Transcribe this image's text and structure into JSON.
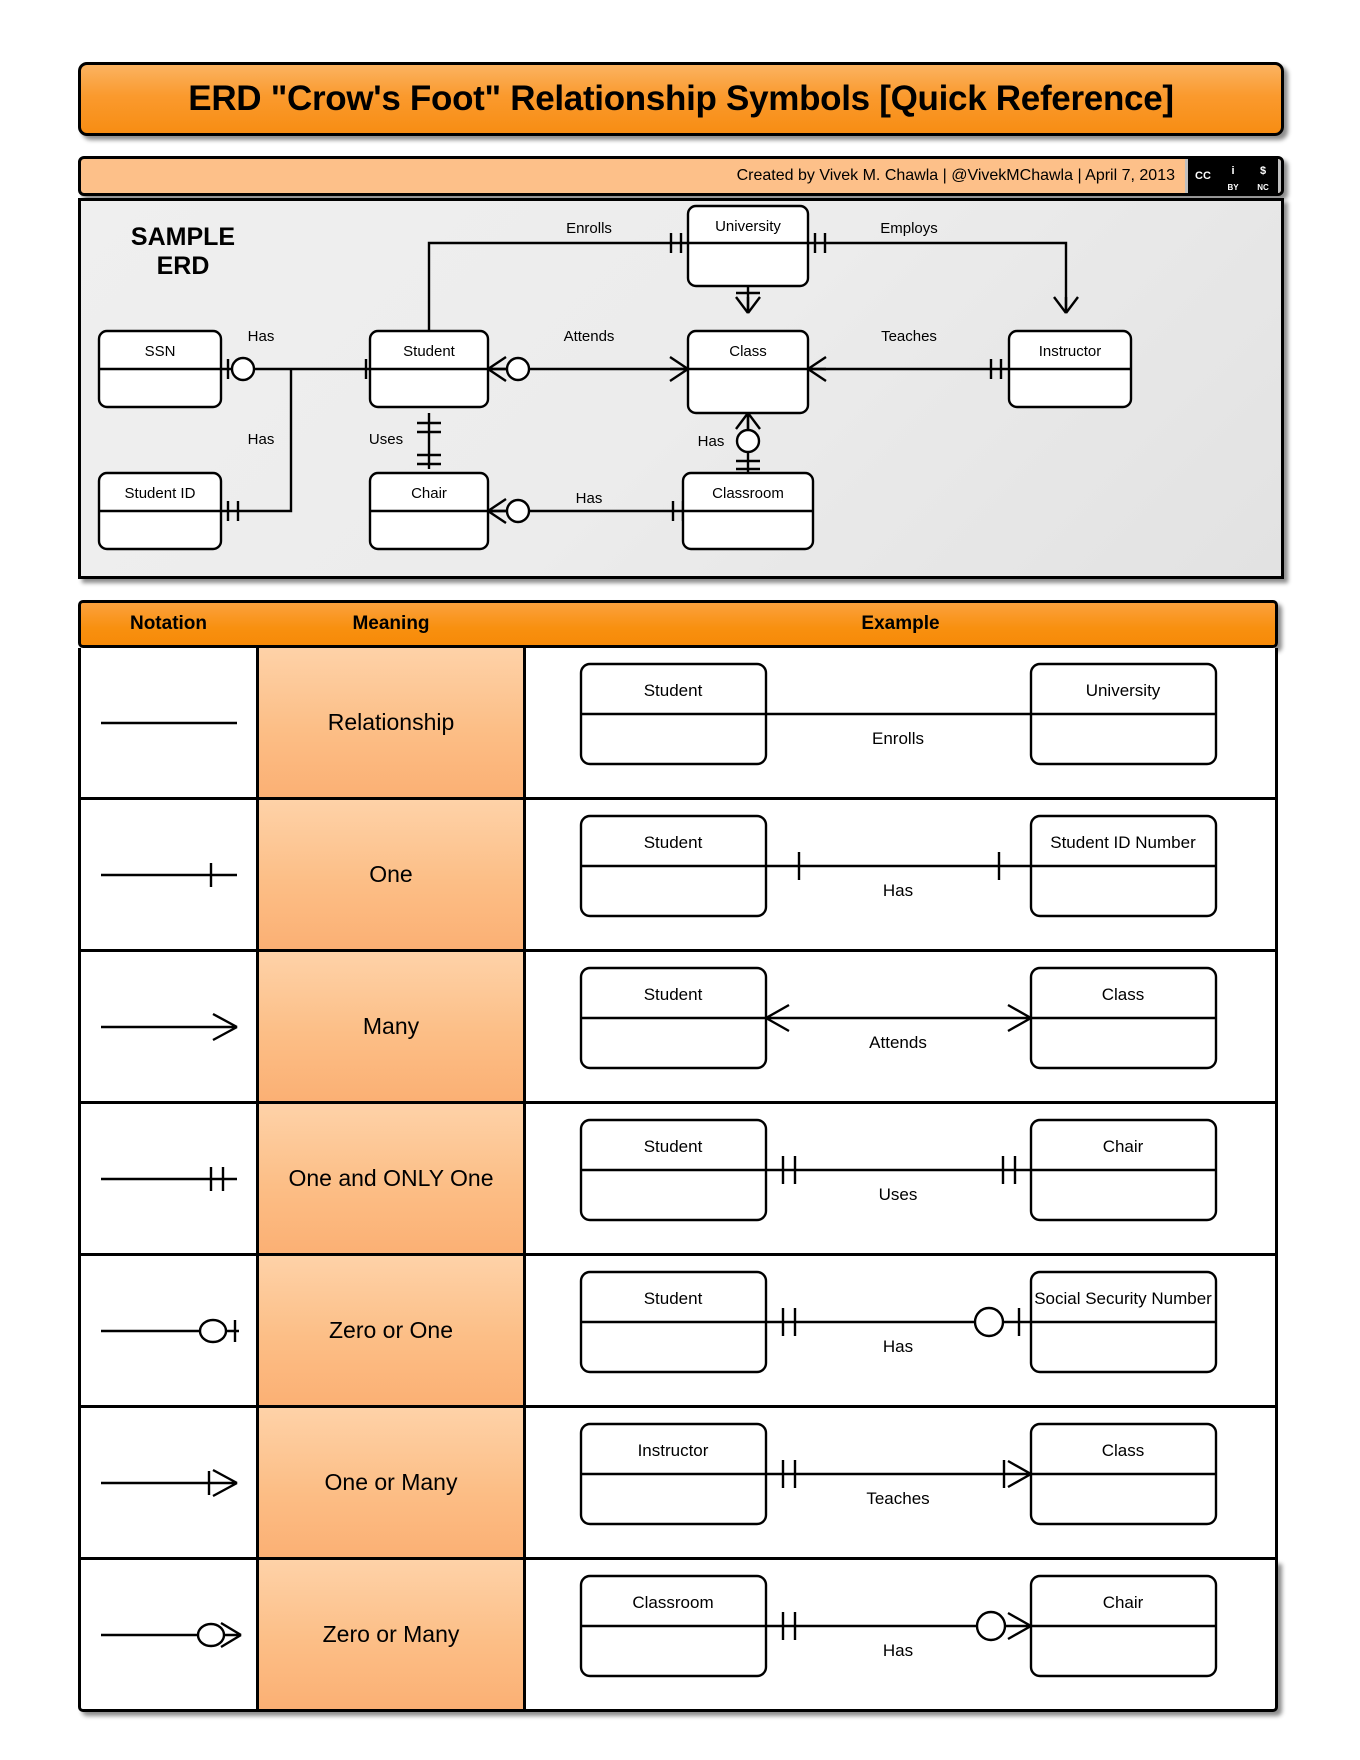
{
  "header": {
    "title": "ERD \"Crow's Foot\" Relationship Symbols [Quick Reference]",
    "credit": "Created by Vivek M. Chawla |  @VivekMChawla  |  April 7, 2013",
    "license": {
      "cc_label": "CC",
      "by_label": "BY",
      "nc_label": "NC",
      "by_glyph": "i",
      "nc_glyph": "$"
    },
    "accent_color": "#f78a08",
    "title_gradient_top": "#fbb361",
    "title_gradient_bottom": "#f88d13",
    "credit_bg": "#fdc089"
  },
  "sample_erd": {
    "panel_label_line1": "SAMPLE",
    "panel_label_line2": "ERD",
    "entities": [
      {
        "id": "ssn",
        "name": "SSN"
      },
      {
        "id": "student_id",
        "name": "Student ID"
      },
      {
        "id": "student",
        "name": "Student"
      },
      {
        "id": "chair",
        "name": "Chair"
      },
      {
        "id": "university",
        "name": "University"
      },
      {
        "id": "class",
        "name": "Class"
      },
      {
        "id": "classroom",
        "name": "Classroom"
      },
      {
        "id": "instructor",
        "name": "Instructor"
      }
    ],
    "relationships": [
      {
        "label": "Has",
        "from": "ssn",
        "to": "student"
      },
      {
        "label": "Has",
        "from": "student_id",
        "to": "student"
      },
      {
        "label": "Uses",
        "from": "student",
        "to": "chair"
      },
      {
        "label": "Enrolls",
        "from": "student",
        "to": "university"
      },
      {
        "label": "Attends",
        "from": "student",
        "to": "class"
      },
      {
        "label": "Teaches",
        "from": "class",
        "to": "instructor"
      },
      {
        "label": "Employs",
        "from": "university",
        "to": "instructor"
      },
      {
        "label": "Has",
        "from": "class",
        "to": "classroom"
      },
      {
        "label": "Has",
        "from": "chair",
        "to": "classroom"
      }
    ]
  },
  "table": {
    "columns": {
      "notation": "Notation",
      "meaning": "Meaning",
      "example": "Example"
    },
    "rows": [
      {
        "meaning": "Relationship",
        "notation": "line",
        "example": {
          "left_entity": "Student",
          "right_entity": "University",
          "label": "Enrolls",
          "left_symbol": "none",
          "right_symbol": "none"
        }
      },
      {
        "meaning": "One",
        "notation": "one",
        "example": {
          "left_entity": "Student",
          "right_entity": "Student ID Number",
          "label": "Has",
          "left_symbol": "one",
          "right_symbol": "one"
        }
      },
      {
        "meaning": "Many",
        "notation": "many",
        "example": {
          "left_entity": "Student",
          "right_entity": "Class",
          "label": "Attends",
          "left_symbol": "many",
          "right_symbol": "many"
        }
      },
      {
        "meaning": "One and ONLY One",
        "notation": "one-only-one",
        "example": {
          "left_entity": "Student",
          "right_entity": "Chair",
          "label": "Uses",
          "left_symbol": "one-only-one",
          "right_symbol": "one-only-one"
        }
      },
      {
        "meaning": "Zero or One",
        "notation": "zero-or-one",
        "example": {
          "left_entity": "Student",
          "right_entity": "Social Security Number",
          "label": "Has",
          "left_symbol": "one-only-one",
          "right_symbol": "zero-or-one"
        }
      },
      {
        "meaning": "One or Many",
        "notation": "one-or-many",
        "example": {
          "left_entity": "Instructor",
          "right_entity": "Class",
          "label": "Teaches",
          "left_symbol": "one-only-one",
          "right_symbol": "one-or-many"
        }
      },
      {
        "meaning": "Zero or Many",
        "notation": "zero-or-many",
        "example": {
          "left_entity": "Classroom",
          "right_entity": "Chair",
          "label": "Has",
          "left_symbol": "one-only-one",
          "right_symbol": "zero-or-many"
        }
      }
    ]
  }
}
